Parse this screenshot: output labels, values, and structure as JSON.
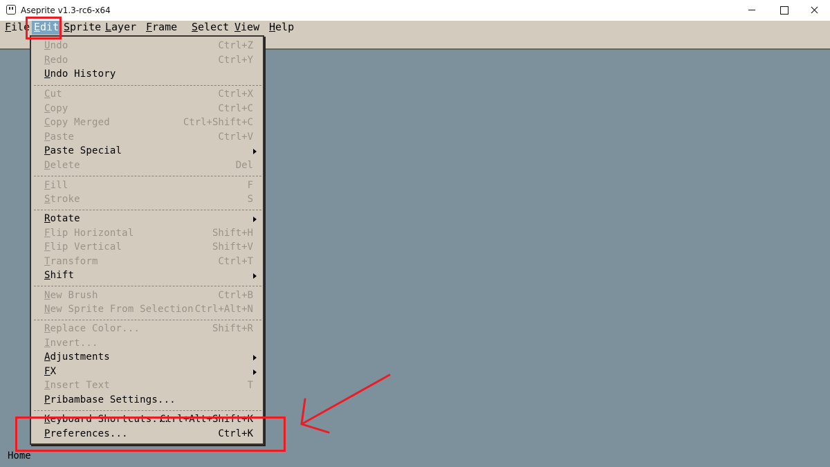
{
  "window": {
    "title": "Aseprite v1.3-rc6-x64"
  },
  "menubar": [
    {
      "label": "File",
      "active": false
    },
    {
      "label": "Edit",
      "active": true
    },
    {
      "label": "Sprite",
      "active": false
    },
    {
      "label": "Layer",
      "active": false
    },
    {
      "label": "Frame",
      "active": false
    },
    {
      "label": "Select",
      "active": false
    },
    {
      "label": "View",
      "active": false
    },
    {
      "label": "Help",
      "active": false
    }
  ],
  "edit_menu": {
    "items": [
      {
        "label": "Undo",
        "shortcut": "Ctrl+Z",
        "enabled": false
      },
      {
        "label": "Redo",
        "shortcut": "Ctrl+Y",
        "enabled": false
      },
      {
        "label": "Undo History",
        "shortcut": "",
        "enabled": true
      },
      {
        "label": "Cut",
        "shortcut": "Ctrl+X",
        "enabled": false
      },
      {
        "label": "Copy",
        "shortcut": "Ctrl+C",
        "enabled": false
      },
      {
        "label": "Copy Merged",
        "shortcut": "Ctrl+Shift+C",
        "enabled": false
      },
      {
        "label": "Paste",
        "shortcut": "Ctrl+V",
        "enabled": false
      },
      {
        "label": "Paste Special",
        "shortcut": "",
        "enabled": true,
        "submenu": true
      },
      {
        "label": "Delete",
        "shortcut": "Del",
        "enabled": false
      },
      {
        "label": "Fill",
        "shortcut": "F",
        "enabled": false
      },
      {
        "label": "Stroke",
        "shortcut": "S",
        "enabled": false
      },
      {
        "label": "Rotate",
        "shortcut": "",
        "enabled": true,
        "submenu": true
      },
      {
        "label": "Flip Horizontal",
        "shortcut": "Shift+H",
        "enabled": false
      },
      {
        "label": "Flip Vertical",
        "shortcut": "Shift+V",
        "enabled": false
      },
      {
        "label": "Transform",
        "shortcut": "Ctrl+T",
        "enabled": false
      },
      {
        "label": "Shift",
        "shortcut": "",
        "enabled": true,
        "submenu": true
      },
      {
        "label": "New Brush",
        "shortcut": "Ctrl+B",
        "enabled": false
      },
      {
        "label": "New Sprite From Selection",
        "shortcut": "Ctrl+Alt+N",
        "enabled": false
      },
      {
        "label": "Replace Color...",
        "shortcut": "Shift+R",
        "enabled": false
      },
      {
        "label": "Invert...",
        "shortcut": "",
        "enabled": false
      },
      {
        "label": "Adjustments",
        "shortcut": "",
        "enabled": true,
        "submenu": true
      },
      {
        "label": "FX",
        "shortcut": "",
        "enabled": true,
        "submenu": true
      },
      {
        "label": "Insert Text",
        "shortcut": "T",
        "enabled": false
      },
      {
        "label": "Pribambase Settings...",
        "shortcut": "",
        "enabled": true
      },
      {
        "label": "Keyboard Shortcuts...",
        "shortcut": "Ctrl+Alt+Shift+K",
        "enabled": true
      },
      {
        "label": "Preferences...",
        "shortcut": "Ctrl+K",
        "enabled": true
      }
    ]
  },
  "status": {
    "text": "Home"
  },
  "colors": {
    "annotation_red": "#ec1c24",
    "workspace": "#7d919c",
    "menu_bg": "#d3cbbe",
    "menu_active": "#7ba5c0",
    "disabled_text": "#9c9388"
  }
}
